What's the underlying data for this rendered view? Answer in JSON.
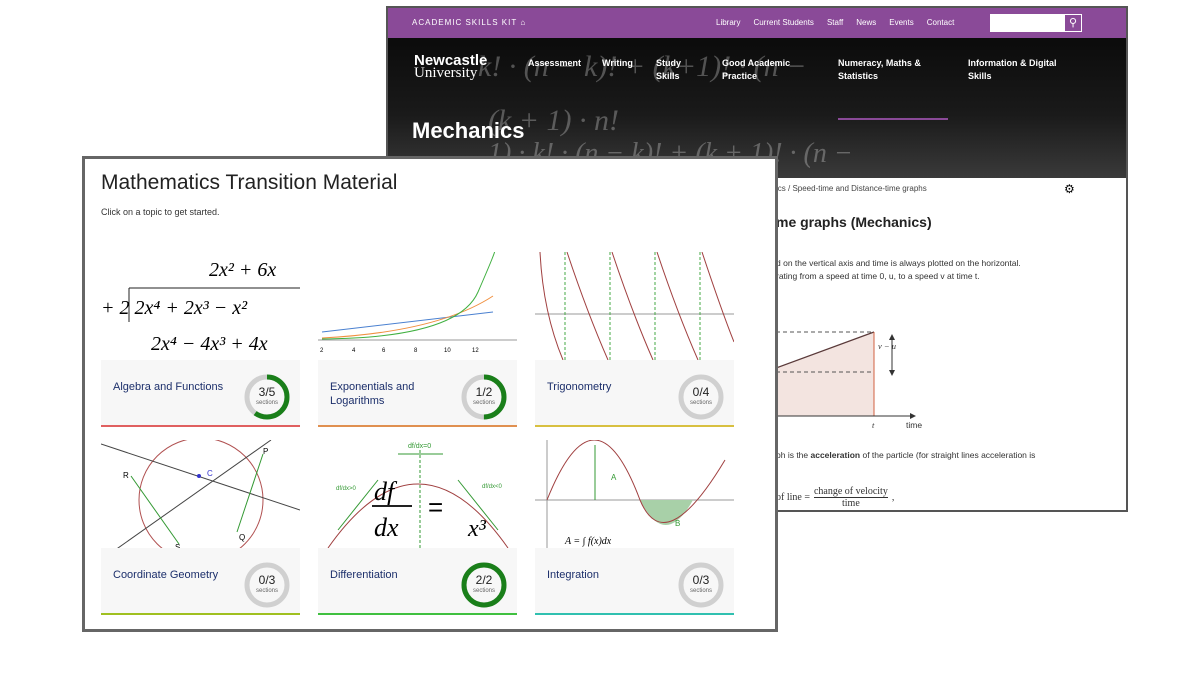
{
  "back_window": {
    "topbar": {
      "kit_label": "ACADEMIC SKILLS KIT",
      "home_icon": "home-icon",
      "links": [
        "Library",
        "Current Students",
        "Staff",
        "News",
        "Events",
        "Contact"
      ],
      "search_icon": "search-icon",
      "search_value": ""
    },
    "logo": {
      "line1": "Newcastle",
      "line2": "University"
    },
    "nav": [
      {
        "label": "Assessment"
      },
      {
        "label": "Writing"
      },
      {
        "label": "Study Skills"
      },
      {
        "label": "Good Academic Practice"
      },
      {
        "label": "Numeracy, Maths & Statistics",
        "active": true
      },
      {
        "label": "Information & Digital Skills"
      }
    ],
    "accent": "#8a4a98",
    "hero_title": "Mechanics",
    "breadcrumb": "ics  /  Speed-time and Distance-time graphs",
    "settings_icon": "gear-icon",
    "heading": "me graphs (Mechanics)",
    "para1": "d on the vertical axis and time is always plotted on the horizontal.",
    "para2": "rating from a speed at time 0, u, to a speed v at time t.",
    "graph": {
      "label_vu": "v − u",
      "label_t": "t",
      "label_time": "time"
    },
    "para3_pre": "ph is the ",
    "para3_bold": "acceleration",
    "para3_post": " of the particle (for straight lines acceleration is",
    "formula": {
      "lhs": "of line =",
      "num": "change of velocity",
      "den": "time"
    }
  },
  "front_window": {
    "title": "Mathematics Transition Material",
    "subtitle": "Click on a topic to get started.",
    "sections_label": "sections",
    "progress_color": "#1a7f1a",
    "cards": [
      {
        "title": "Algebra and Functions",
        "done": 3,
        "total": 5,
        "progress": "3/5",
        "color": "#e06060"
      },
      {
        "title": "Exponentials and Logarithms",
        "done": 1,
        "total": 2,
        "progress": "1/2",
        "color": "#e09050"
      },
      {
        "title": "Trigonometry",
        "done": 0,
        "total": 4,
        "progress": "0/4",
        "color": "#d8c040"
      },
      {
        "title": "Coordinate Geometry",
        "done": 0,
        "total": 3,
        "progress": "0/3",
        "color": "#a0c020"
      },
      {
        "title": "Differentiation",
        "done": 2,
        "total": 2,
        "progress": "2/2",
        "color": "#40c040"
      },
      {
        "title": "Integration",
        "done": 0,
        "total": 3,
        "progress": "0/3",
        "color": "#30c0b0"
      }
    ]
  }
}
